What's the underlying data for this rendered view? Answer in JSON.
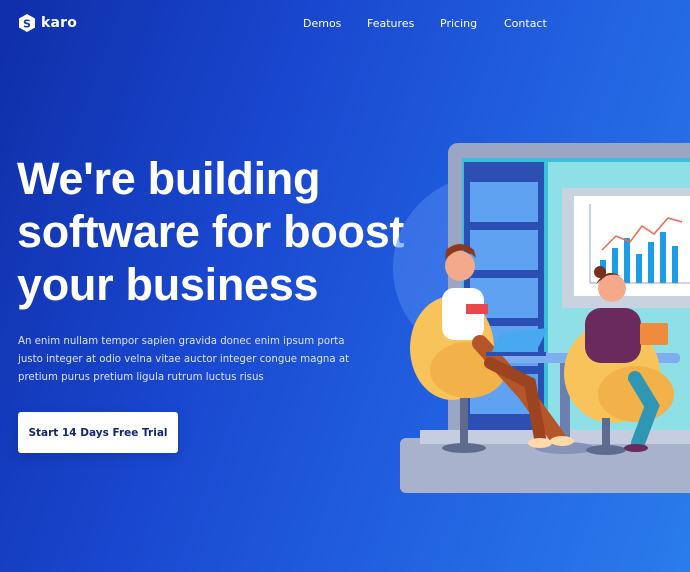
{
  "brand": {
    "logo_letter": "S",
    "name": "karo"
  },
  "nav": {
    "items": [
      {
        "label": "Demos"
      },
      {
        "label": "Features"
      },
      {
        "label": "Pricing"
      },
      {
        "label": "Contact"
      }
    ]
  },
  "hero": {
    "title": "We're building software for boost your business",
    "description": "An enim nullam tempor sapien gravida donec enim ipsum porta justo integer at odio velna vitae auctor integer congue magna at pretium purus pretium ligula rutrum luctus risus",
    "cta_label": "Start 14 Days Free Trial"
  },
  "colors": {
    "background_start": "#0f2ea8",
    "background_end": "#2a7cec",
    "cta_bg": "#ffffff",
    "cta_text": "#14256f"
  },
  "icons": {
    "logo": "s-hexagon-logo-icon"
  }
}
